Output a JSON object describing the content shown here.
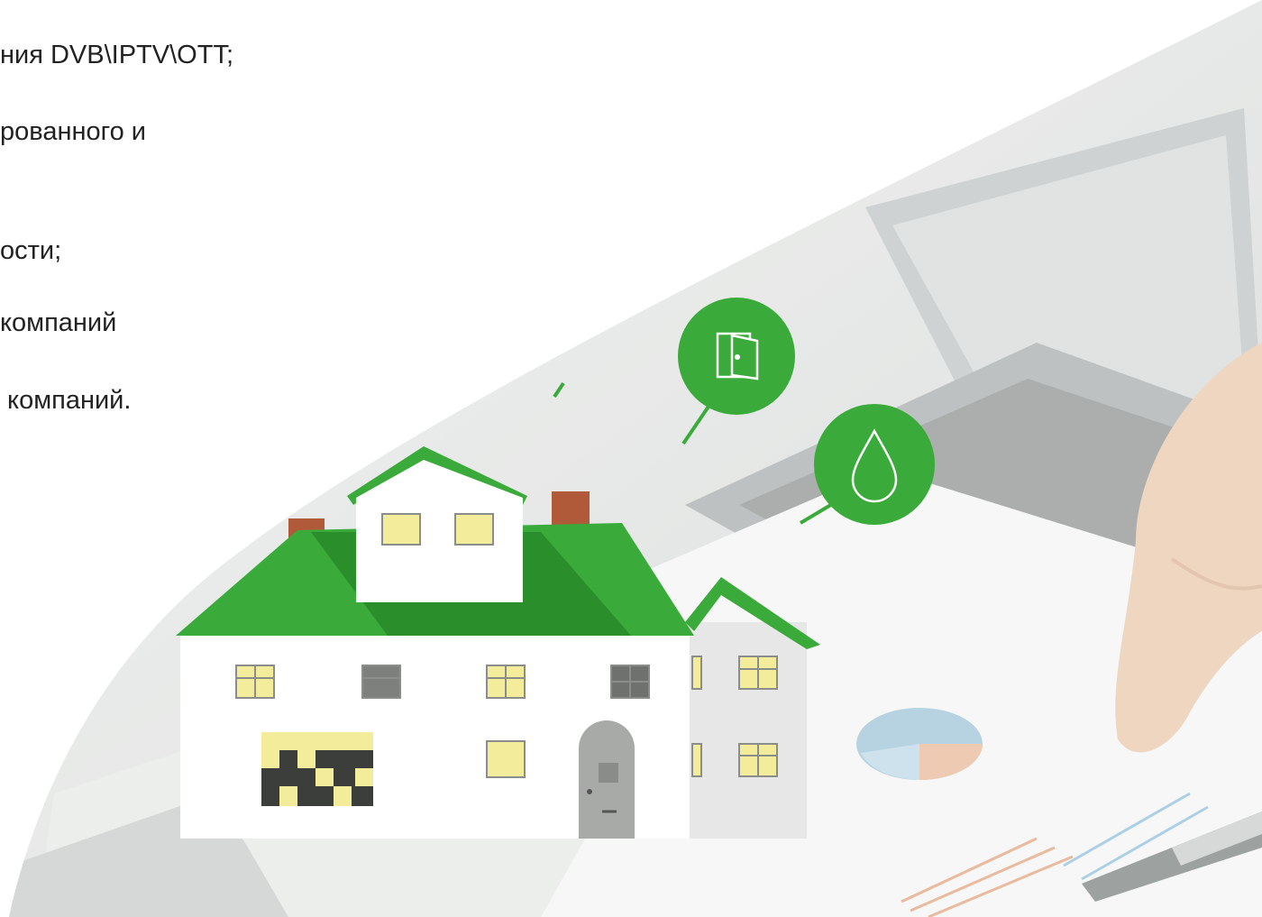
{
  "slide": {
    "lines": [
      "ния DVB\\IPTV\\OTT;",
      "рованного и",
      "ости;",
      "компаний",
      " компаний."
    ]
  },
  "illustration": {
    "icons": [
      "door-icon",
      "water-drop-icon"
    ],
    "accent_color": "#3aab3a",
    "roof_dark_color": "#2a8f2a"
  }
}
